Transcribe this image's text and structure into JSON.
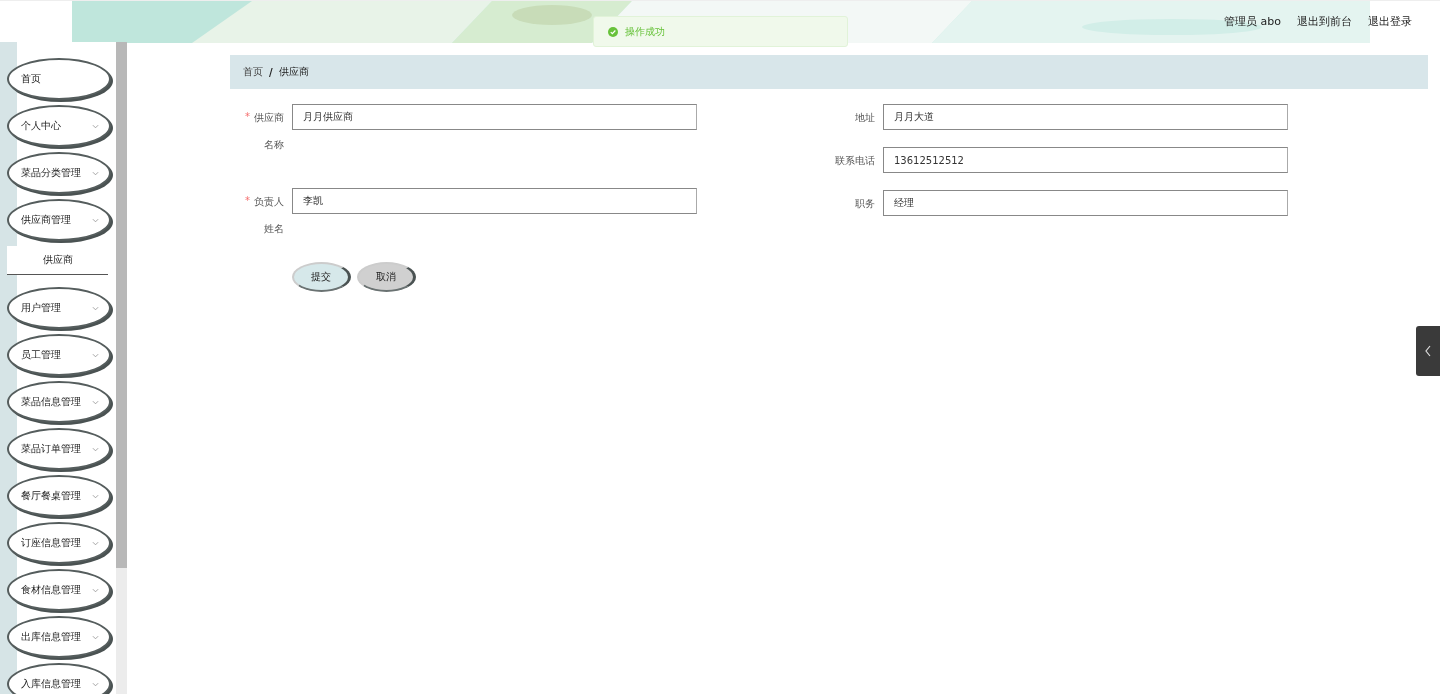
{
  "header": {
    "user": "管理员 abo",
    "links": [
      "退出到前台",
      "退出登录"
    ]
  },
  "toast": {
    "message": "操作成功"
  },
  "sidebar": {
    "items": [
      {
        "label": "首页",
        "kind": "link"
      },
      {
        "label": "个人中心",
        "kind": "submenu"
      },
      {
        "label": "菜品分类管理",
        "kind": "submenu"
      },
      {
        "label": "供应商管理",
        "kind": "submenu",
        "children": [
          {
            "label": "供应商"
          }
        ]
      },
      {
        "label": "用户管理",
        "kind": "submenu"
      },
      {
        "label": "员工管理",
        "kind": "submenu"
      },
      {
        "label": "菜品信息管理",
        "kind": "submenu"
      },
      {
        "label": "菜品订单管理",
        "kind": "submenu"
      },
      {
        "label": "餐厅餐桌管理",
        "kind": "submenu"
      },
      {
        "label": "订座信息管理",
        "kind": "submenu"
      },
      {
        "label": "食材信息管理",
        "kind": "submenu"
      },
      {
        "label": "出库信息管理",
        "kind": "submenu"
      },
      {
        "label": "入库信息管理",
        "kind": "submenu"
      }
    ]
  },
  "breadcrumb": {
    "items": [
      "首页",
      "供应商"
    ],
    "separator": "/"
  },
  "form": {
    "left": [
      {
        "label": "供应商名称",
        "required_mark": "*",
        "value": "月月供应商"
      },
      {
        "label": "负责人姓名",
        "required_mark": "*",
        "value": "李凯"
      }
    ],
    "right": [
      {
        "label": "地址",
        "value": "月月大道"
      },
      {
        "label": "联系电话",
        "value": "13612512512"
      },
      {
        "label": "职务",
        "value": "经理"
      }
    ],
    "buttons": [
      {
        "label": "提交",
        "kind": "primary"
      },
      {
        "label": "取消",
        "kind": "secondary"
      }
    ]
  }
}
